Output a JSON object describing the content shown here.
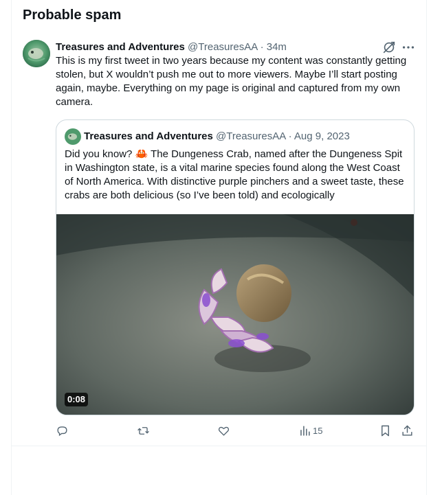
{
  "section": {
    "title": "Probable spam"
  },
  "tweet": {
    "author_name": "Treasures and Adventures",
    "handle": "@TreasuresAA",
    "separator": "·",
    "time": "34m",
    "text": "This is my first tweet in two years because my content was constantly getting stolen, but X wouldn’t push me out to more viewers. Maybe I’ll start posting again, maybe. Everything on my page is original and captured from my own camera.",
    "icons": [
      "transparency-icon",
      "more-icon"
    ],
    "quote": {
      "author_name": "Treasures and Adventures",
      "handle": "@TreasuresAA",
      "separator": "·",
      "date": "Aug 9, 2023",
      "text_before_emoji": "Did you know? ",
      "emoji": "🦀",
      "text_after_emoji": " The Dungeness Crab, named after the Dungeness Spit in Washington state, is a vital marine species found along the West Coast of North America. With distinctive purple pinchers and a sweet taste, these crabs are both delicious (so I’ve been told) and ecologically",
      "video": {
        "duration": "0:08",
        "subject": "crab-video-thumbnail"
      }
    },
    "actions": {
      "reply": {
        "icon": "reply-icon",
        "count": ""
      },
      "repost": {
        "icon": "repost-icon",
        "count": ""
      },
      "like": {
        "icon": "like-icon",
        "count": ""
      },
      "views": {
        "icon": "views-icon",
        "count": "15"
      },
      "bookmark": {
        "icon": "bookmark-icon"
      },
      "share": {
        "icon": "share-icon"
      }
    }
  },
  "colors": {
    "text": "#0f1419",
    "muted": "#536471",
    "border": "#cfd9de",
    "divider": "#eff3f4"
  }
}
